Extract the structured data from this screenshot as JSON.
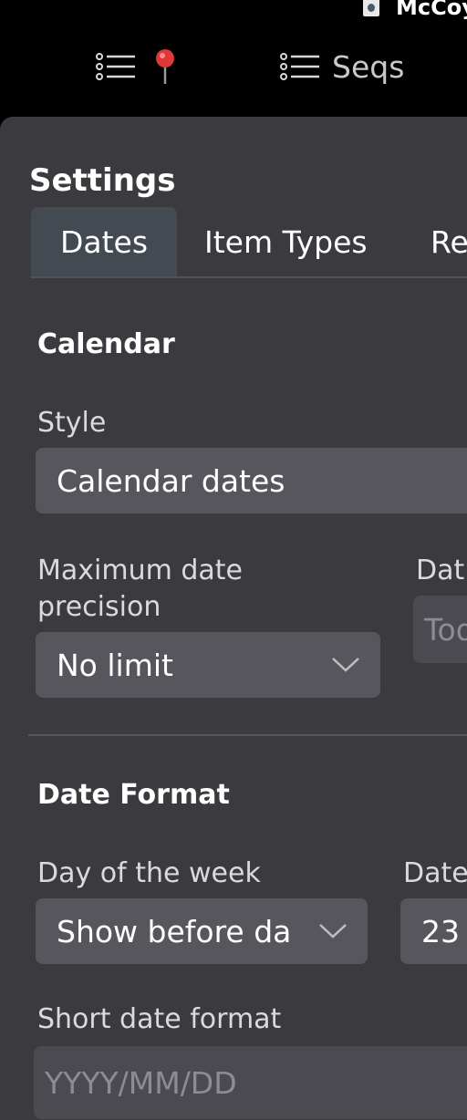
{
  "header": {
    "user_name": "McCoy",
    "nav": [
      {
        "label": ""
      },
      {
        "label": "Seqs"
      }
    ]
  },
  "settings": {
    "title": "Settings",
    "tabs": [
      {
        "label": "Dates",
        "active": true
      },
      {
        "label": "Item Types",
        "active": false
      },
      {
        "label": "Re",
        "active": false
      }
    ],
    "calendar": {
      "heading": "Calendar",
      "style_label": "Style",
      "style_value": "Calendar dates",
      "max_precision_label_line1": "Maximum date",
      "max_precision_label_line2": "precision",
      "max_precision_value": "No limit",
      "right_field_label": "Dat",
      "right_field_placeholder": "Tod"
    },
    "date_format": {
      "heading": "Date Format",
      "day_of_week_label": "Day of the week",
      "day_of_week_value": "Show before da",
      "right_field_label": "Date",
      "right_field_value": "23",
      "short_format_label": "Short date format",
      "short_format_placeholder": "YYYY/MM/DD"
    }
  },
  "colors": {
    "background": "#000000",
    "panel": "#3b3b3f",
    "field": "#56565c",
    "active_tab": "#444a52"
  }
}
